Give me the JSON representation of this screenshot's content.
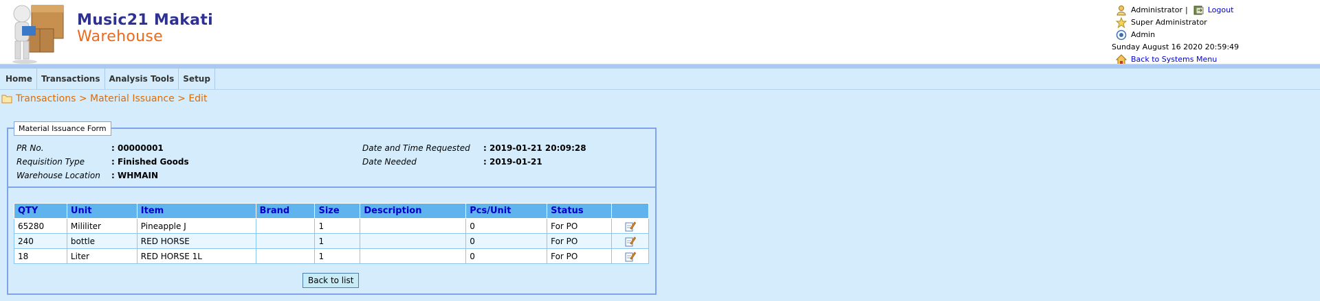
{
  "header": {
    "brand_line1": "Music21 Makati",
    "brand_line2": "Warehouse",
    "user": {
      "name": "Administrator",
      "separator": "|",
      "logout": "Logout",
      "role": "Super Administrator",
      "group": "Admin",
      "datetime": "Sunday August 16 2020 20:59:49",
      "back_link": "Back to Systems Menu"
    }
  },
  "nav": {
    "items": [
      "Home",
      "Transactions",
      "Analysis Tools",
      "Setup"
    ]
  },
  "breadcrumb": "Transactions > Material Issuance > Edit",
  "form": {
    "legend": "Material Issuance Form",
    "left": [
      {
        "label": "PR No.",
        "value": ": 00000001"
      },
      {
        "label": "Requisition Type",
        "value": ": Finished Goods"
      },
      {
        "label": "Warehouse Location",
        "value": ": WHMAIN"
      }
    ],
    "right": [
      {
        "label": "Date and Time Requested",
        "value": ": 2019-01-21 20:09:28"
      },
      {
        "label": "Date Needed",
        "value": ": 2019-01-21"
      }
    ]
  },
  "table": {
    "columns": [
      "QTY",
      "Unit",
      "Item",
      "Brand",
      "Size",
      "Description",
      "Pcs/Unit",
      "Status"
    ],
    "rows": [
      [
        "65280",
        "Mililiter",
        "Pineapple J",
        "",
        "1",
        "",
        "0",
        "For PO"
      ],
      [
        "240",
        "bottle",
        "RED HORSE",
        "",
        "1",
        "",
        "0",
        "For PO"
      ],
      [
        "18",
        "Liter",
        "RED HORSE 1L",
        "",
        "1",
        "",
        "0",
        "For PO"
      ]
    ]
  },
  "buttons": {
    "back": "Back to list"
  },
  "icons": {
    "user": "user-icon",
    "logout": "logout-icon",
    "role": "star-icon",
    "group": "group-icon",
    "home": "home-icon",
    "folder": "folder-icon",
    "edit": "edit-icon"
  },
  "colors": {
    "brand_blue": "#2e3192",
    "brand_orange": "#ee6a1b",
    "page_bg": "#d4ecfb",
    "table_header": "#5fb4ee",
    "link": "#0000cc",
    "breadcrumb": "#e06b00"
  }
}
